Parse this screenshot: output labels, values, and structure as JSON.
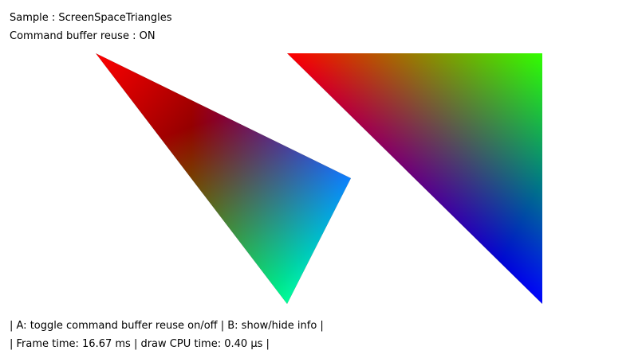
{
  "overlay": {
    "sample_line": "Sample : ScreenSpaceTriangles",
    "reuse_line": "Command buffer reuse : ON",
    "help_line": "|  A: toggle command buffer reuse on/off  |  B: show/hide info  |",
    "timing_line": "|  Frame time: 16.67 ms  |  draw CPU time: 0.40 µs  |"
  },
  "scene": {
    "background": "#ffffff",
    "triangles": [
      {
        "name": "triangle-left",
        "vertex_colors": [
          "#ff0000",
          "#0000ff",
          "#00ff00"
        ]
      },
      {
        "name": "triangle-right",
        "vertex_colors": [
          "#ff0000",
          "#00ff00",
          "#0000ff"
        ]
      }
    ]
  },
  "status": {
    "command_buffer_reuse": "ON",
    "frame_time_ms": 16.67,
    "draw_cpu_time_us": 0.4
  }
}
